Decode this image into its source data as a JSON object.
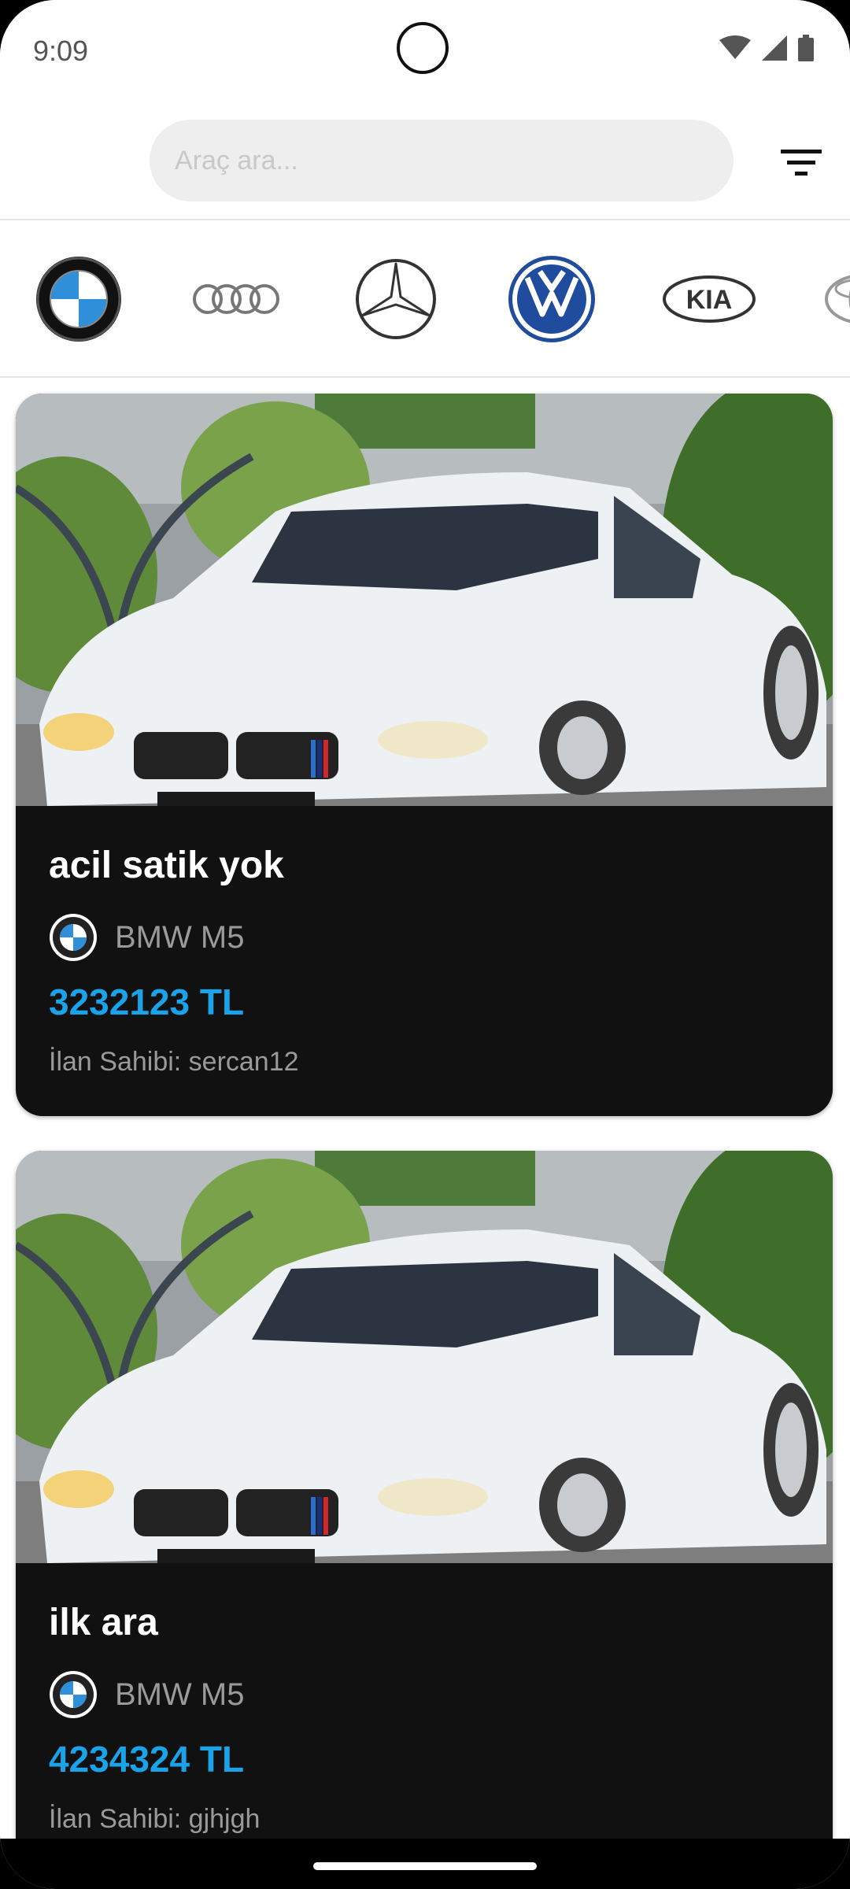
{
  "status": {
    "time": "9:09"
  },
  "search": {
    "placeholder": "Araç ara..."
  },
  "brands": [
    "bmw-logo",
    "audi-logo",
    "mercedes-logo",
    "volkswagen-logo",
    "kia-logo",
    "toyota-logo"
  ],
  "brand_labels": {
    "kia": "KIA"
  },
  "listings": [
    {
      "title": "acil satik yok",
      "model": "BMW M5",
      "price": "3232123 TL",
      "owner": "İlan Sahibi: sercan12"
    },
    {
      "title": "ilk ara",
      "model": "BMW M5",
      "price": "4234324 TL",
      "owner": "İlan Sahibi: gjhjgh"
    }
  ],
  "colors": {
    "price": "#1aa3e8",
    "card_bg": "#111111"
  }
}
